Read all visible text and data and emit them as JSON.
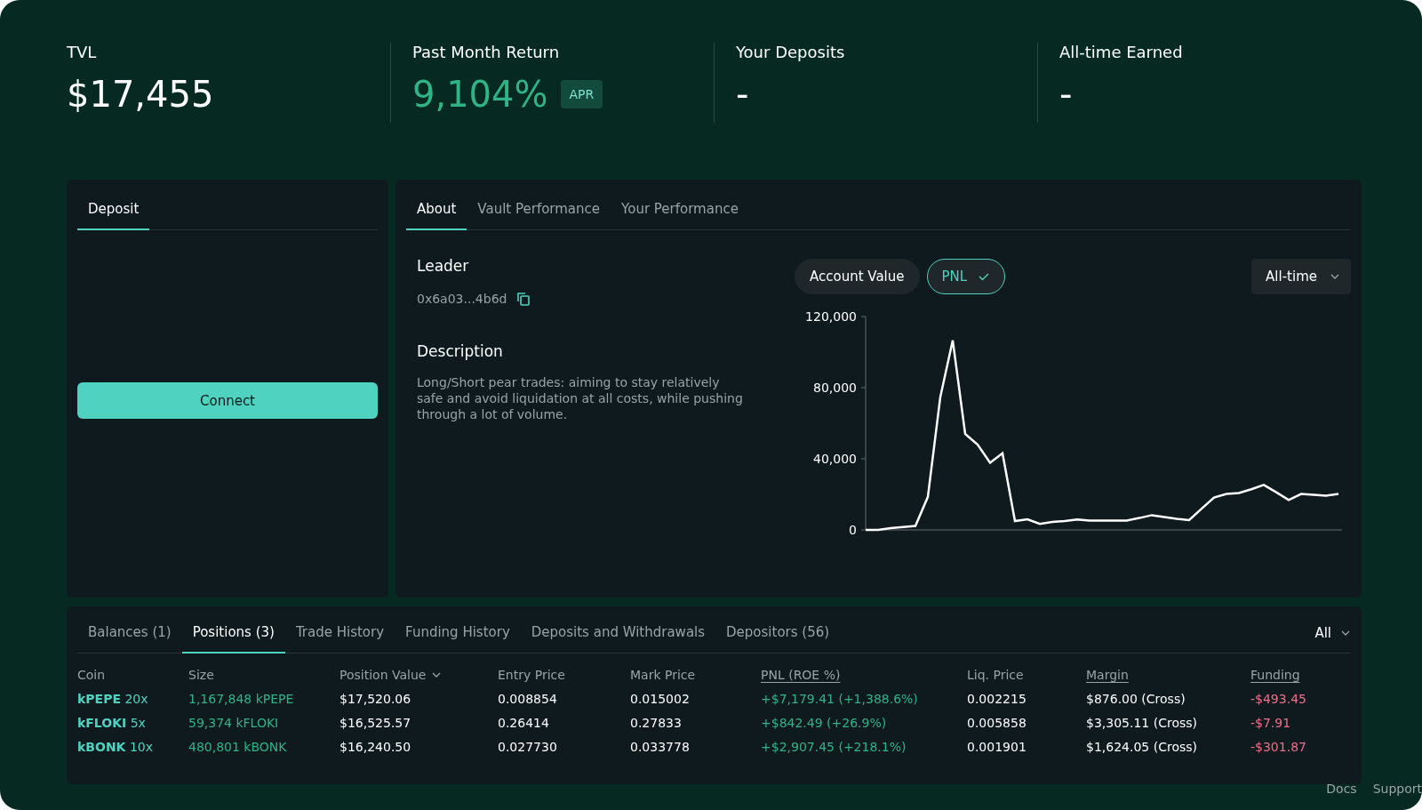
{
  "stats": [
    {
      "label": "TVL",
      "value": "$17,455",
      "positive": false
    },
    {
      "label": "Past Month Return",
      "value": "9,104%",
      "positive": true,
      "badge": "APR"
    },
    {
      "label": "Your Deposits",
      "value": "-",
      "positive": false
    },
    {
      "label": "All-time Earned",
      "value": "-",
      "positive": false
    }
  ],
  "deposit_panel": {
    "tabs": [
      {
        "label": "Deposit",
        "selected": true
      }
    ],
    "button": "Connect"
  },
  "about_panel": {
    "tabs": [
      {
        "label": "About",
        "selected": true
      },
      {
        "label": "Vault Performance",
        "selected": false
      },
      {
        "label": "Your Performance",
        "selected": false
      }
    ],
    "leader_heading": "Leader",
    "leader_address": "0x6a03...4b6d",
    "description_heading": "Description",
    "description": "Long/Short pear trades: aiming to stay relatively safe and avoid liquidation at all costs, while pushing through a lot of volume.",
    "chart_toggles": [
      {
        "label": "Account Value",
        "selected": false
      },
      {
        "label": "PNL",
        "selected": true
      }
    ],
    "range_dropdown": "All-time",
    "chart_data": {
      "type": "line",
      "ylim": [
        0,
        120000
      ],
      "yticks": [
        {
          "value": 0,
          "label": "0"
        },
        {
          "value": 40000,
          "label": "40,000"
        },
        {
          "value": 80000,
          "label": "80,000"
        },
        {
          "value": 120000,
          "label": "120,000"
        }
      ],
      "series": [
        {
          "color": "#ffffff",
          "values": [
            0,
            0,
            1000,
            1600,
            2200,
            18600,
            74700,
            106600,
            54000,
            48000,
            37800,
            43100,
            5000,
            6000,
            3400,
            4500,
            5000,
            5900,
            5300,
            5300,
            5300,
            5300,
            6700,
            8300,
            7300,
            6300,
            5500,
            11900,
            18200,
            20200,
            20800,
            22900,
            25300,
            21200,
            16800,
            20200,
            19800,
            19200,
            20200
          ]
        }
      ]
    }
  },
  "positions_panel": {
    "tabs": [
      {
        "label": "Balances (1)",
        "selected": false
      },
      {
        "label": "Positions (3)",
        "selected": true
      },
      {
        "label": "Trade History",
        "selected": false
      },
      {
        "label": "Funding History",
        "selected": false
      },
      {
        "label": "Deposits and Withdrawals",
        "selected": false
      },
      {
        "label": "Depositors (56)",
        "selected": false
      }
    ],
    "filter": "All",
    "columns": [
      {
        "label": "Coin",
        "underlined": false,
        "sortable": false
      },
      {
        "label": "Size",
        "underlined": false,
        "sortable": false
      },
      {
        "label": "Position Value",
        "underlined": false,
        "sortable": true
      },
      {
        "label": "Entry Price",
        "underlined": false,
        "sortable": false
      },
      {
        "label": "Mark Price",
        "underlined": false,
        "sortable": false
      },
      {
        "label": "PNL (ROE %)",
        "underlined": true,
        "sortable": false
      },
      {
        "label": "Liq. Price",
        "underlined": false,
        "sortable": false
      },
      {
        "label": "Margin",
        "underlined": true,
        "sortable": false
      },
      {
        "label": "Funding",
        "underlined": true,
        "sortable": false
      }
    ],
    "rows": [
      {
        "coin": "kPEPE",
        "leverage": "20x",
        "size": "1,167,848 kPEPE",
        "position_value": "$17,520.06",
        "entry_price": "0.008854",
        "mark_price": "0.015002",
        "pnl": "+$7,179.41 (+1,388.6%)",
        "liq_price": "0.002215",
        "margin": "$876.00 (Cross)",
        "funding": "-$493.45"
      },
      {
        "coin": "kFLOKI",
        "leverage": "5x",
        "size": "59,374 kFLOKI",
        "position_value": "$16,525.57",
        "entry_price": "0.26414",
        "mark_price": "0.27833",
        "pnl": "+$842.49 (+26.9%)",
        "liq_price": "0.005858",
        "margin": "$3,305.11 (Cross)",
        "funding": "-$7.91"
      },
      {
        "coin": "kBONK",
        "leverage": "10x",
        "size": "480,801 kBONK",
        "position_value": "$16,240.50",
        "entry_price": "0.027730",
        "mark_price": "0.033778",
        "pnl": "+$2,907.45 (+218.1%)",
        "liq_price": "0.001901",
        "margin": "$1,624.05 (Cross)",
        "funding": "-$301.87"
      }
    ]
  },
  "footer_links": [
    "Docs",
    "Support"
  ]
}
